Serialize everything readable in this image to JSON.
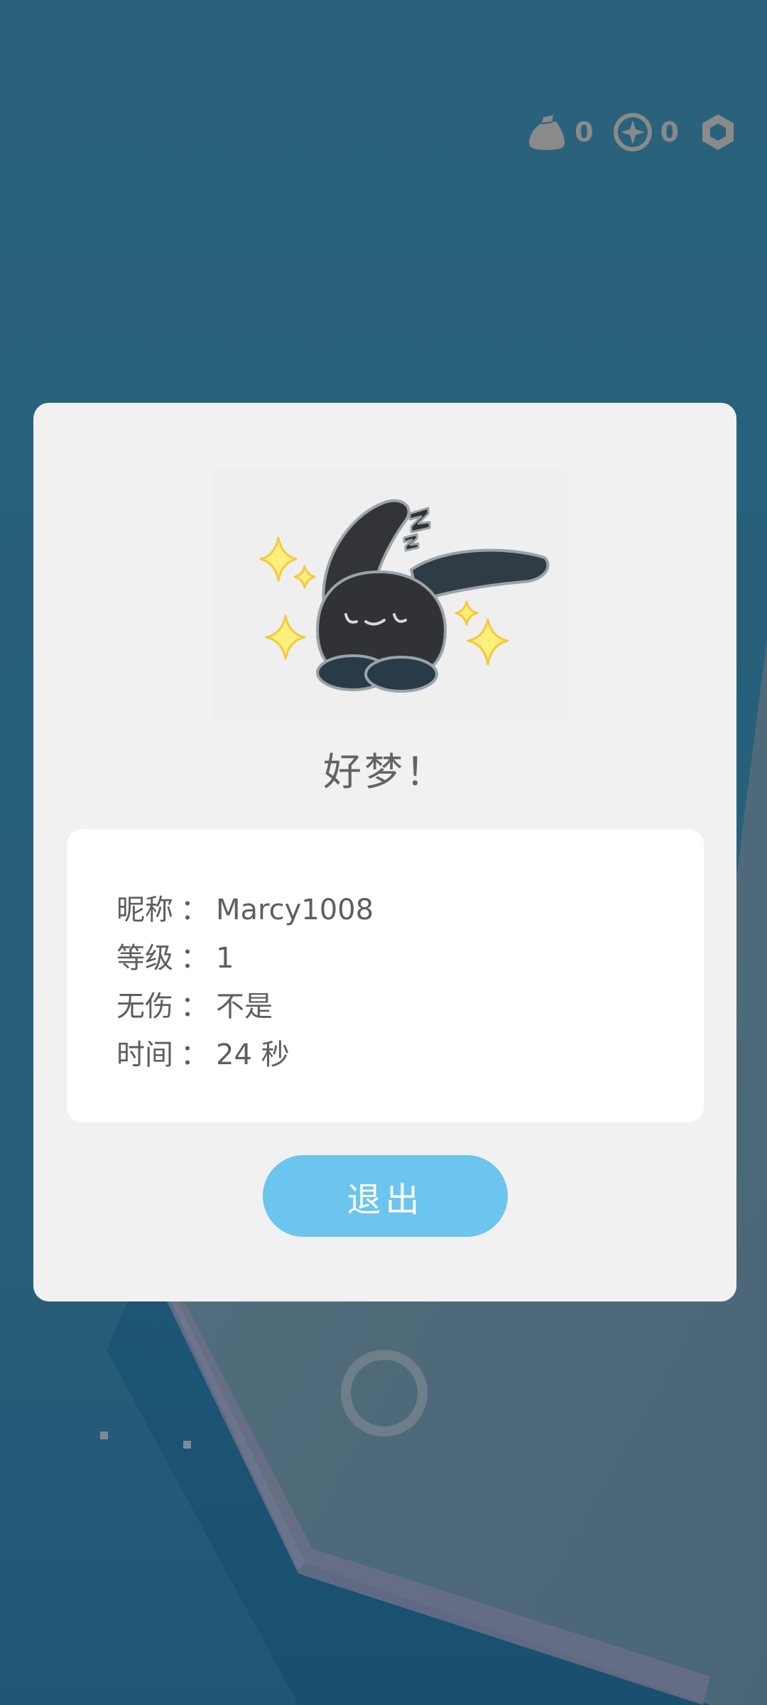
{
  "hud": {
    "currency_bag": {
      "icon": "coin-bag-icon",
      "count": "0"
    },
    "currency_coin": {
      "icon": "compass-coin-icon",
      "count": "0"
    },
    "settings": {
      "icon": "hexagon-settings-icon"
    }
  },
  "dialog": {
    "mascot_icon": "sleeping-bunny-icon",
    "title": "好梦！",
    "info": {
      "nickname_label": "昵称",
      "nickname_value": "Marcy1008",
      "level_label": "等级",
      "level_value": "1",
      "no_damage_label": "无伤",
      "no_damage_value": "不是",
      "time_label": "时间",
      "time_value": "24 秒",
      "separator": "："
    },
    "exit_label": "退出"
  },
  "colors": {
    "background": "#2a627c",
    "card": "#f1f1f1",
    "panel": "#ffffff",
    "button": "#6bc5ef",
    "text": "#5e5e5e"
  }
}
